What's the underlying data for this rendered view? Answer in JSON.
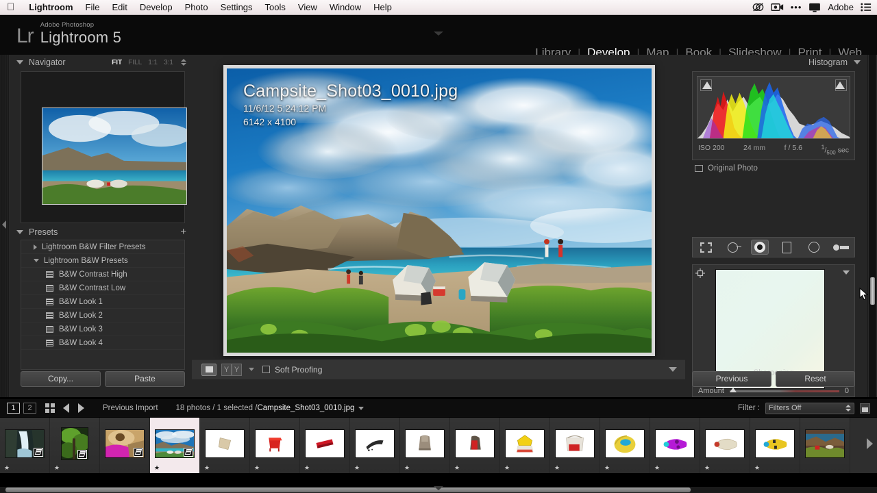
{
  "macbar": {
    "apple_icon": "apple-icon",
    "menus": [
      "Lightroom",
      "File",
      "Edit",
      "Develop",
      "Photo",
      "Settings",
      "Tools",
      "View",
      "Window",
      "Help"
    ],
    "status_label": "Adobe",
    "status_icons": [
      "creative-cloud-icon",
      "screen-record-icon",
      "overflow-dots-icon",
      "display-icon",
      "list-menu-icon"
    ]
  },
  "app": {
    "logo_mark": "Lr",
    "logo_superscript": "Adobe Photoshop",
    "logo_name": "Lightroom 5",
    "modules": [
      {
        "label": "Library",
        "active": false
      },
      {
        "label": "Develop",
        "active": true
      },
      {
        "label": "Map",
        "active": false
      },
      {
        "label": "Book",
        "active": false
      },
      {
        "label": "Slideshow",
        "active": false
      },
      {
        "label": "Print",
        "active": false
      },
      {
        "label": "Web",
        "active": false
      }
    ]
  },
  "left_panel": {
    "navigator": {
      "title": "Navigator",
      "zoom_levels": [
        {
          "label": "FIT",
          "active": true
        },
        {
          "label": "FILL",
          "active": false
        },
        {
          "label": "1:1",
          "active": false
        },
        {
          "label": "3:1",
          "active": false
        }
      ]
    },
    "presets": {
      "title": "Presets",
      "add_label": "+",
      "items": [
        {
          "label": "Lightroom B&W Filter Presets",
          "type": "folder",
          "expanded": false
        },
        {
          "label": "Lightroom B&W Presets",
          "type": "folder",
          "expanded": true
        },
        {
          "label": "B&W Contrast High",
          "type": "preset"
        },
        {
          "label": "B&W Contrast Low",
          "type": "preset"
        },
        {
          "label": "B&W Look 1",
          "type": "preset"
        },
        {
          "label": "B&W Look 2",
          "type": "preset"
        },
        {
          "label": "B&W Look 3",
          "type": "preset"
        },
        {
          "label": "B&W Look 4",
          "type": "preset"
        }
      ]
    },
    "buttons": {
      "copy": "Copy...",
      "paste": "Paste"
    }
  },
  "photo_info": {
    "filename": "Campsite_Shot03_0010.jpg",
    "datetime": "11/6/12 5:24:12 PM",
    "dimensions": "6142 x 4100"
  },
  "toolbar": {
    "view_icon": "loupe-view-icon",
    "compare_labels": [
      "Y",
      "Y"
    ],
    "soft_proofing_label": "Soft Proofing",
    "soft_proofing_checked": false
  },
  "right_panel": {
    "histogram": {
      "title": "Histogram",
      "exif": {
        "iso": "ISO 200",
        "focal": "24 mm",
        "aperture": "f / 5.6",
        "shutter_num": "1",
        "shutter_den": "500",
        "shutter_unit": "sec"
      },
      "original_photo_label": "Original Photo",
      "original_photo_checked": false
    },
    "tools": [
      {
        "name": "crop-overlay-tool",
        "selected": false
      },
      {
        "name": "spot-removal-tool",
        "selected": false
      },
      {
        "name": "red-eye-correction-tool",
        "selected": true
      },
      {
        "name": "graduated-filter-tool",
        "selected": false
      },
      {
        "name": "radial-filter-tool",
        "selected": false
      },
      {
        "name": "adjustment-brush-tool",
        "selected": false
      }
    ],
    "detail": {
      "sharpening_title": "Sharpening",
      "amount_label": "Amount",
      "amount_value": "0"
    },
    "buttons": {
      "previous": "Previous",
      "reset": "Reset"
    }
  },
  "filmstrip_bar": {
    "pages": [
      {
        "label": "1",
        "active": true
      },
      {
        "label": "2",
        "active": false
      }
    ],
    "grid_icon": "grid-view-icon",
    "back_icon": "back-arrow-icon",
    "forward_icon": "forward-arrow-icon",
    "source": "Previous Import",
    "count": "18 photos / 1 selected /",
    "filename": "Campsite_Shot03_0010.jpg",
    "filter_label": "Filter :",
    "filter_value": "Filters Off"
  },
  "filmstrip": {
    "thumbs": [
      {
        "name": "waterfall",
        "star": "★",
        "badge": true,
        "selected": false,
        "tall": false,
        "c1": "#2e4a5e",
        "c2": "#cfe4ef",
        "c3": "#1d2f23"
      },
      {
        "name": "forest",
        "star": "★",
        "badge": true,
        "selected": false,
        "tall": true,
        "c1": "#23401c",
        "c2": "#6fa63b",
        "c3": "#14240f"
      },
      {
        "name": "pink-gear-closeup",
        "star": "",
        "badge": true,
        "selected": false,
        "tall": false,
        "c1": "#c9a46a",
        "c2": "#d224b0",
        "c3": "#8d6a3a"
      },
      {
        "name": "campsite-beach",
        "star": "★",
        "badge": true,
        "selected": true,
        "tall": false,
        "c1": "#2a7bbd",
        "c2": "#cfe8f2",
        "c3": "#4e8a3a"
      },
      {
        "name": "tan-mat-product",
        "star": "★",
        "badge": false,
        "selected": false,
        "tall": false,
        "c1": "#ffffff",
        "c2": "#d9c9a8",
        "c3": "#ffffff"
      },
      {
        "name": "red-chair-product",
        "star": "★",
        "badge": false,
        "selected": false,
        "tall": false,
        "c1": "#ffffff",
        "c2": "#d8231f",
        "c3": "#ffffff"
      },
      {
        "name": "red-chair-folded-product",
        "star": "★",
        "badge": false,
        "selected": false,
        "tall": false,
        "c1": "#ffffff",
        "c2": "#cf1724",
        "c3": "#ffffff"
      },
      {
        "name": "black-gear-product",
        "star": "★",
        "badge": false,
        "selected": false,
        "tall": false,
        "c1": "#ffffff",
        "c2": "#2a2a2a",
        "c3": "#ffffff"
      },
      {
        "name": "backpack-grey-product",
        "star": "★",
        "badge": false,
        "selected": false,
        "tall": false,
        "c1": "#ffffff",
        "c2": "#9b8d7c",
        "c3": "#ffffff"
      },
      {
        "name": "red-backpack-product",
        "star": "★",
        "badge": false,
        "selected": false,
        "tall": false,
        "c1": "#ffffff",
        "c2": "#cf2323",
        "c3": "#ffffff"
      },
      {
        "name": "yellow-tent-product",
        "star": "★",
        "badge": false,
        "selected": false,
        "tall": false,
        "c1": "#ffffff",
        "c2": "#f2d014",
        "c3": "#d94a3a"
      },
      {
        "name": "clear-bag-product",
        "star": "★",
        "badge": false,
        "selected": false,
        "tall": false,
        "c1": "#ffffff",
        "c2": "#cfc9bd",
        "c3": "#cf2323"
      },
      {
        "name": "yellow-blue-bag-product",
        "star": "★",
        "badge": false,
        "selected": false,
        "tall": false,
        "c1": "#ffffff",
        "c2": "#e8cf3a",
        "c3": "#22a8d6"
      },
      {
        "name": "purple-sleeping-bag-product",
        "star": "★",
        "badge": false,
        "selected": false,
        "tall": false,
        "c1": "#ffffff",
        "c2": "#b51ad6",
        "c3": "#6d0f82"
      },
      {
        "name": "cream-sleeping-bag-product",
        "star": "★",
        "badge": false,
        "selected": false,
        "tall": false,
        "c1": "#ffffff",
        "c2": "#e3dcc6",
        "c3": "#c4b79a"
      },
      {
        "name": "yellow-sleeping-bag-product",
        "star": "★",
        "badge": false,
        "selected": false,
        "tall": false,
        "c1": "#ffffff",
        "c2": "#e8c520",
        "c3": "#22a8d6"
      },
      {
        "name": "campsite-evening",
        "star": "",
        "badge": false,
        "selected": false,
        "tall": false,
        "c1": "#5c4330",
        "c2": "#2b6a8c",
        "c3": "#6f8a2c"
      }
    ]
  },
  "cursor": {
    "icon": "mouse-pointer-icon"
  }
}
